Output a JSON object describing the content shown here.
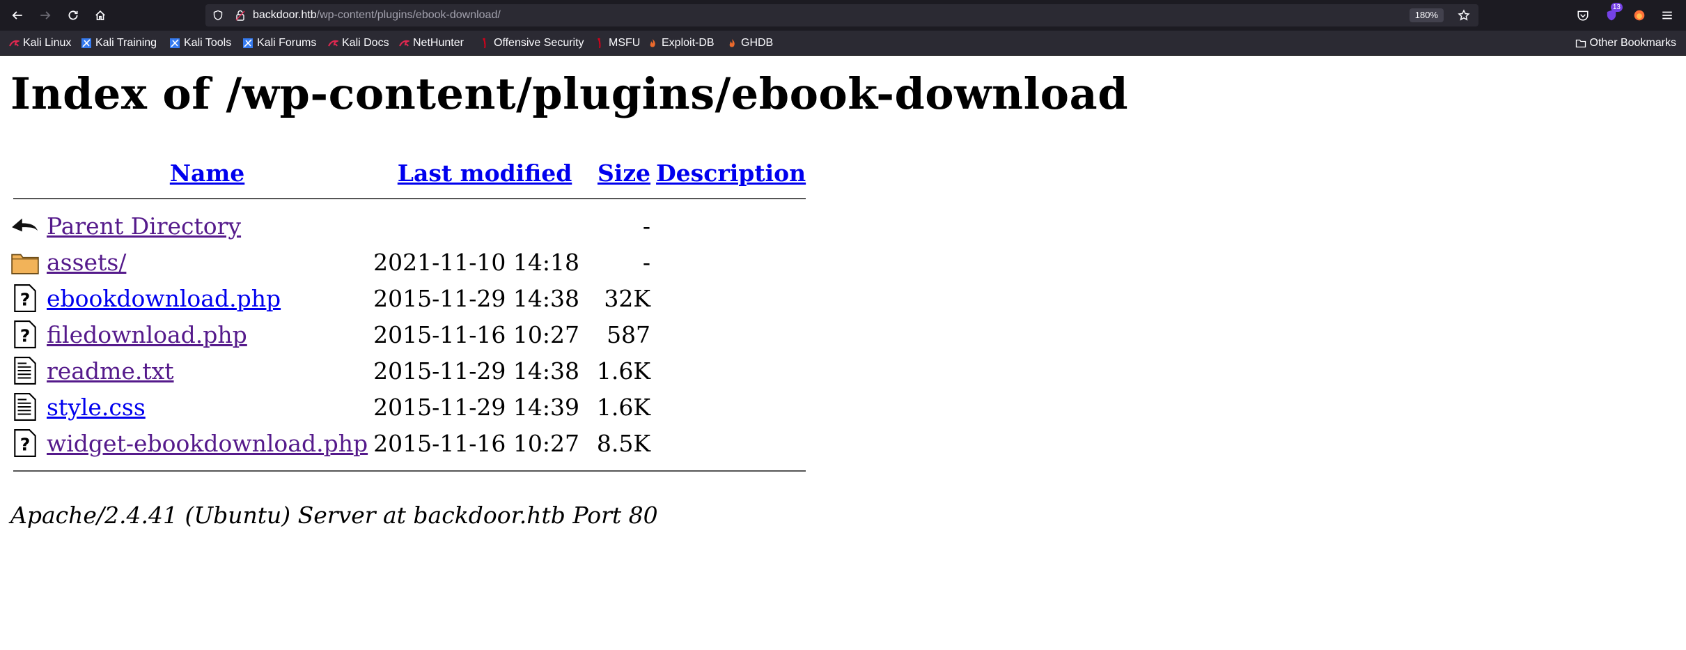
{
  "browser": {
    "url_host": "backdoor.htb",
    "url_path": "/wp-content/plugins/ebook-download/",
    "zoom": "180%",
    "extension_badge": "13",
    "bookmarks": [
      {
        "label": "Kali Linux",
        "icon": "kali-dragon-icon"
      },
      {
        "label": "Kali Training",
        "icon": "kali-training-icon"
      },
      {
        "label": "Kali Tools",
        "icon": "kali-tools-icon"
      },
      {
        "label": "Kali Forums",
        "icon": "kali-forums-icon"
      },
      {
        "label": "Kali Docs",
        "icon": "kali-docs-icon"
      },
      {
        "label": "NetHunter",
        "icon": "nethunter-icon"
      },
      {
        "label": "Offensive Security",
        "icon": "offsec-icon"
      },
      {
        "label": "MSFU",
        "icon": "msfu-icon"
      },
      {
        "label": "Exploit-DB",
        "icon": "exploit-db-icon"
      },
      {
        "label": "GHDB",
        "icon": "ghdb-icon"
      }
    ],
    "other_bookmarks": "Other Bookmarks"
  },
  "page": {
    "title": "Index of /wp-content/plugins/ebook-download",
    "columns": {
      "name": "Name",
      "last_modified": "Last modified",
      "size": "Size",
      "description": "Description"
    },
    "rows": [
      {
        "icon": "back-arrow-icon",
        "name": "Parent Directory",
        "modified": "",
        "size": "-",
        "visited": true
      },
      {
        "icon": "folder-icon",
        "name": "assets/",
        "modified": "2021-11-10 14:18",
        "size": "-",
        "visited": true
      },
      {
        "icon": "unknown-file-icon",
        "name": "ebookdownload.php",
        "modified": "2015-11-29 14:38",
        "size": "32K",
        "visited": false
      },
      {
        "icon": "unknown-file-icon",
        "name": "filedownload.php",
        "modified": "2015-11-16 10:27",
        "size": "587",
        "visited": true
      },
      {
        "icon": "text-file-icon",
        "name": "readme.txt",
        "modified": "2015-11-29 14:38",
        "size": "1.6K",
        "visited": true
      },
      {
        "icon": "text-file-icon",
        "name": "style.css",
        "modified": "2015-11-29 14:39",
        "size": "1.6K",
        "visited": false
      },
      {
        "icon": "unknown-file-icon",
        "name": "widget-ebookdownload.php",
        "modified": "2015-11-16 10:27",
        "size": "8.5K",
        "visited": true
      }
    ],
    "server_signature": "Apache/2.4.41 (Ubuntu) Server at backdoor.htb Port 80"
  },
  "colors": {
    "link": "#0000ee",
    "visited_link": "#551a8b",
    "chrome_dark": "#1c1b22",
    "urlbar": "#2b2a33"
  }
}
